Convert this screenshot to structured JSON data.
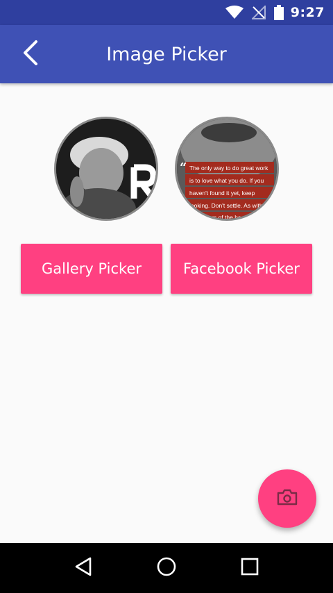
{
  "status_bar": {
    "time": "9:27",
    "icons": [
      "wifi-icon",
      "no-signal-icon",
      "battery-icon"
    ]
  },
  "app_bar": {
    "title": "Image Picker",
    "back_icon": "chevron-left-icon",
    "color": "#3f51b5"
  },
  "images": {
    "first": {
      "subject": "portrait-photo"
    },
    "second": {
      "quote_lines": [
        "The only way to do great work",
        "is to love what you do. If you",
        "haven't found it yet, keep",
        "looking. Don't settle. As with",
        "all matters of the heart."
      ],
      "watermark": "R"
    }
  },
  "buttons": {
    "gallery": "Gallery Picker",
    "facebook": "Facebook Picker",
    "color": "#ff4081"
  },
  "fab": {
    "icon": "camera-icon"
  },
  "nav_bar": {
    "icons": [
      "back-triangle-icon",
      "home-circle-icon",
      "recents-square-icon"
    ]
  }
}
